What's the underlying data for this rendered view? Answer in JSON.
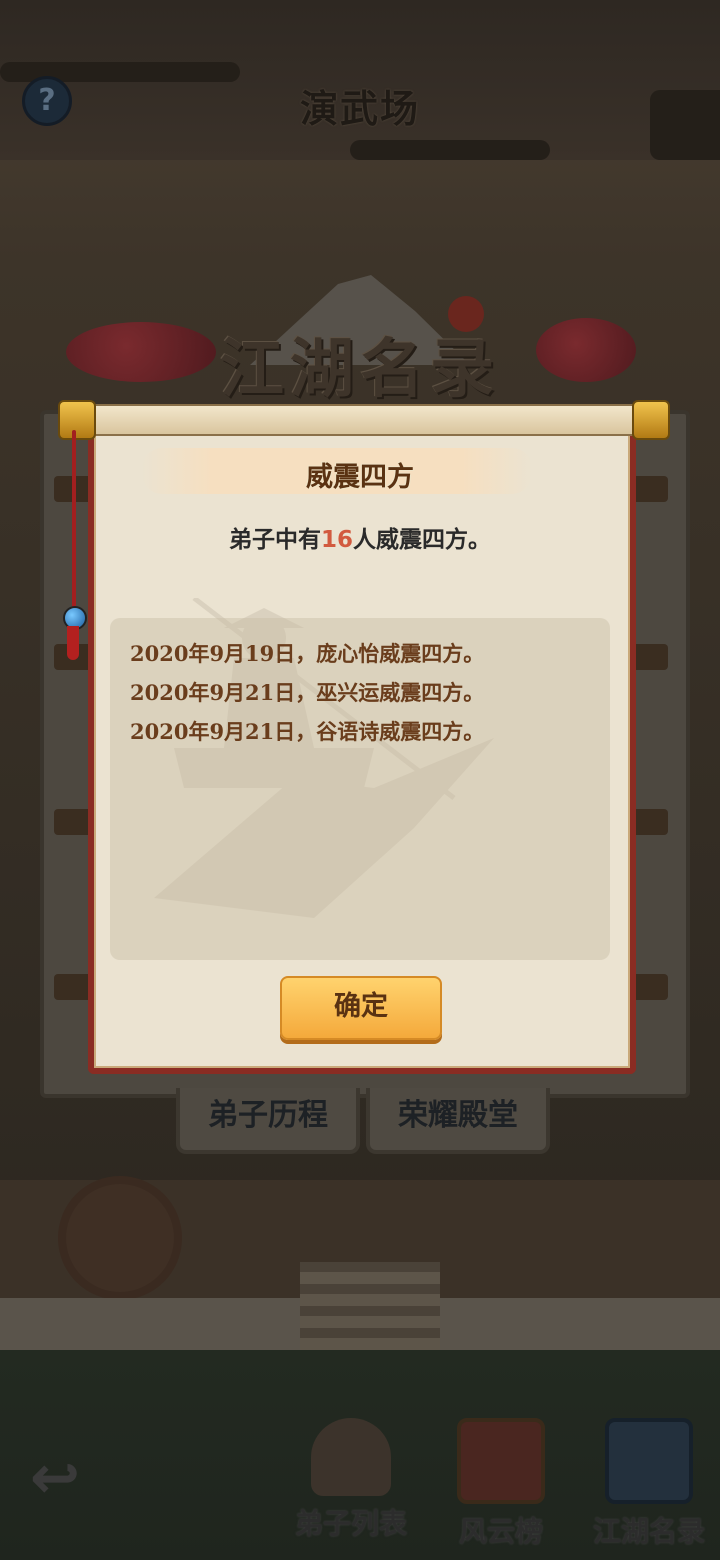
{
  "header": {
    "help_symbol": "?",
    "scene_title": "演武场"
  },
  "banner": {
    "title": "江湖名录"
  },
  "dialog": {
    "title": "威震四方",
    "summary_prefix": "弟子中有",
    "summary_count": "16",
    "summary_suffix": "人威震四方。",
    "records": [
      "2020年9月19日，庞心怡威震四方。",
      "2020年9月21日，巫兴运威震四方。",
      "2020年9月21日，谷语诗威震四方。"
    ],
    "confirm_label": "确定"
  },
  "tabs": [
    {
      "label": "弟子历程"
    },
    {
      "label": "荣耀殿堂"
    }
  ],
  "bottom_nav": {
    "back_symbol": "↩",
    "items": [
      {
        "label": "弟子列表",
        "icon": "disciple-portrait-icon"
      },
      {
        "label": "风云榜",
        "icon": "scroll-board-icon"
      },
      {
        "label": "江湖名录",
        "icon": "book-icon"
      }
    ]
  },
  "colors": {
    "accent_count": "#d25a3e",
    "confirm_button": "#f4a93b",
    "scroll_border": "#8a2c23",
    "record_text": "#6a3d1c"
  }
}
